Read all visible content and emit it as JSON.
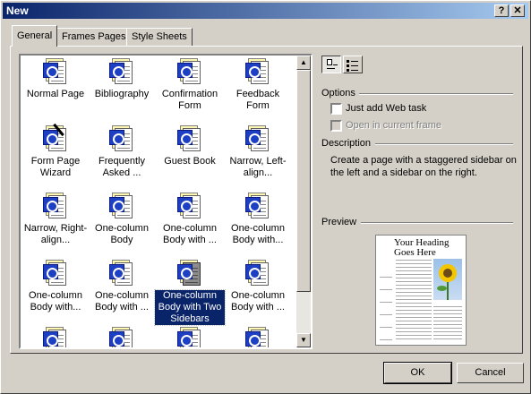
{
  "window": {
    "title": "New",
    "help_label": "?",
    "close_label": "✕"
  },
  "tabs": [
    {
      "label": "General",
      "active": true
    },
    {
      "label": "Frames Pages",
      "active": false
    },
    {
      "label": "Style Sheets",
      "active": false
    }
  ],
  "templates": [
    {
      "label": "Normal Page",
      "icon": "web-page-icon"
    },
    {
      "label": "Bibliography",
      "icon": "web-page-icon"
    },
    {
      "label": "Confirmation Form",
      "icon": "web-page-icon"
    },
    {
      "label": "Feedback Form",
      "icon": "web-page-icon"
    },
    {
      "label": "Form Page Wizard",
      "icon": "wizard-page-icon"
    },
    {
      "label": "Frequently Asked ...",
      "icon": "web-page-icon"
    },
    {
      "label": "Guest Book",
      "icon": "web-page-icon"
    },
    {
      "label": "Narrow, Left-align...",
      "icon": "web-page-icon"
    },
    {
      "label": "Narrow, Right-align...",
      "icon": "web-page-icon"
    },
    {
      "label": "One-column Body",
      "icon": "web-page-icon"
    },
    {
      "label": "One-column Body with ...",
      "icon": "web-page-icon"
    },
    {
      "label": "One-column Body with...",
      "icon": "web-page-icon"
    },
    {
      "label": "One-column Body with...",
      "icon": "web-page-icon"
    },
    {
      "label": "One-column Body with ...",
      "icon": "web-page-icon"
    },
    {
      "label": "One-column Body with Two Sidebars",
      "icon": "web-page-icon",
      "selected": true
    },
    {
      "label": "One-column Body with ...",
      "icon": "web-page-icon"
    },
    {
      "label": "",
      "icon": "web-page-icon"
    },
    {
      "label": "",
      "icon": "web-page-icon"
    },
    {
      "label": "",
      "icon": "web-page-icon"
    },
    {
      "label": "",
      "icon": "web-page-icon"
    }
  ],
  "options": {
    "heading": "Options",
    "add_web_task": {
      "label": "Just add Web task",
      "checked": false,
      "enabled": true
    },
    "open_in_current_frame": {
      "label": "Open in current frame",
      "checked": false,
      "enabled": false
    }
  },
  "description": {
    "heading": "Description",
    "text": "Create a page with a staggered sidebar on the left and a sidebar on the right."
  },
  "preview": {
    "heading": "Preview",
    "page_heading": "Your Heading Goes Here"
  },
  "buttons": {
    "ok": "OK",
    "cancel": "Cancel"
  },
  "colors": {
    "selection": "#0a246a",
    "titlebar_start": "#0a246a",
    "titlebar_end": "#a6caf0",
    "face": "#d4d0c8"
  }
}
